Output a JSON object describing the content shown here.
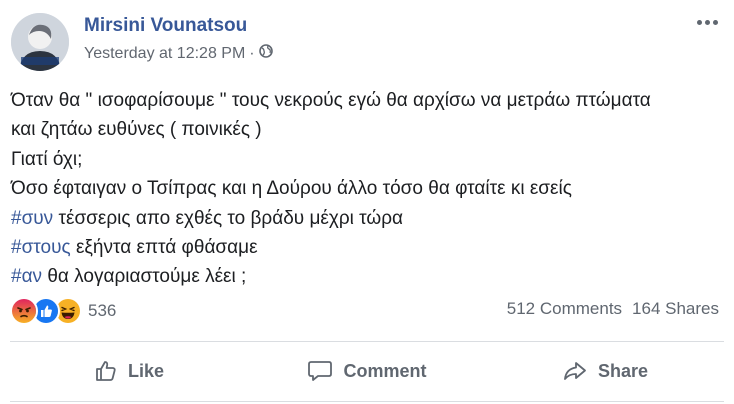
{
  "post": {
    "author": "Mirsini Vounatsou",
    "timestamp": "Yesterday at 12:28 PM",
    "separator": "·",
    "privacy_icon": "globe-icon",
    "menu_icon": "more-options-icon",
    "text_lines": [
      {
        "hashtag": "",
        "text": "Όταν θα \" ισοφαρίσουμε \" τους νεκρούς εγώ θα αρχίσω να μετράω πτώματα"
      },
      {
        "hashtag": "",
        "text": "και ζητάω ευθύνες ( ποινικές )"
      },
      {
        "hashtag": "",
        "text": "Γιατί όχι;"
      },
      {
        "hashtag": "",
        "text": "Όσο έφταιγαν ο Τσίπρας και η Δούρου άλλο τόσο θα φταίτε κι εσείς"
      },
      {
        "hashtag": "#συν",
        "text": "τέσσερις απο εχθές το βράδυ μέχρι τώρα"
      },
      {
        "hashtag": "#στους",
        "text": "εξήντα επτά φθάσαμε"
      },
      {
        "hashtag": "#αν",
        "text": "θα λογαριαστούμε λέει ;"
      }
    ]
  },
  "engagement": {
    "reaction_icons": [
      "angry-reaction-icon",
      "like-reaction-icon",
      "haha-reaction-icon"
    ],
    "reaction_count": "536",
    "comments": "512 Comments",
    "shares": "164 Shares"
  },
  "actions": {
    "like_label": "Like",
    "comment_label": "Comment",
    "share_label": "Share"
  },
  "colors": {
    "link": "#385898",
    "muted": "#606770",
    "like_blue": "#1877f2",
    "angry_orange": "#e9710f",
    "haha_yellow": "#f7b125"
  }
}
